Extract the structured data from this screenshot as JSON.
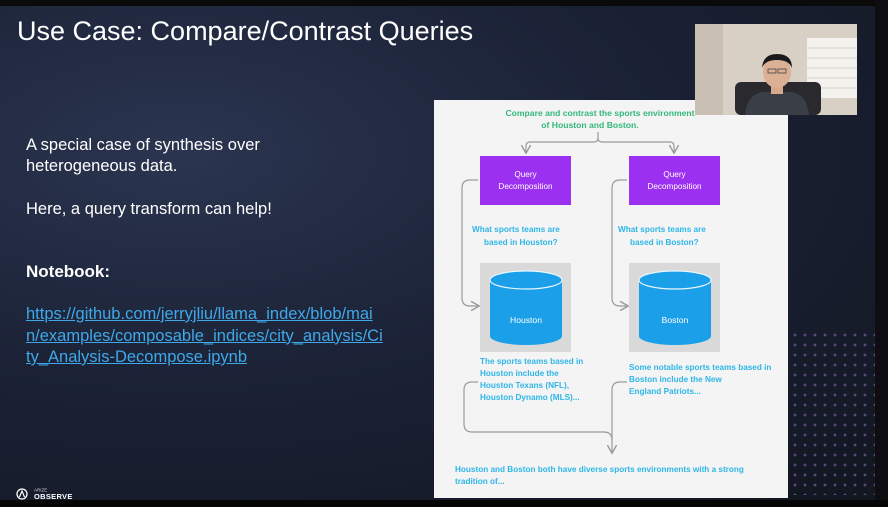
{
  "slide": {
    "title": "Use Case: Compare/Contrast Queries",
    "intro_line1": "A special case of synthesis over",
    "intro_line2": "heterogeneous data.",
    "help_text": "Here, a query transform can help!",
    "notebook_heading": "Notebook:",
    "notebook_link": "https://github.com/jerryjliu/llama_index/blob/main/examples/composable_indices/city_analysis/City_Analysis-Decompose.ipynb"
  },
  "diagram": {
    "top_query_line1": "Compare and contrast the sports environment",
    "top_query_line2": "of Houston and Boston.",
    "left_box_line1": "Query",
    "left_box_line2": "Decomposition",
    "right_box_line1": "Query",
    "right_box_line2": "Decomposition",
    "left_subq_line1": "What sports teams are",
    "left_subq_line2": "based in Houston?",
    "right_subq_line1": "What sports teams are",
    "right_subq_line2": "based in Boston?",
    "left_db_label": "Houston",
    "right_db_label": "Boston",
    "left_ans_line1": "The sports teams based in",
    "left_ans_line2": "Houston include the",
    "left_ans_line3": "Houston Texans (NFL),",
    "left_ans_line4": "Houston Dynamo (MLS)...",
    "right_ans_line1": "Some notable sports teams based in",
    "right_ans_line2": "Boston include the New",
    "right_ans_line3": "England Patriots...",
    "final_line1": "Houston and Boston both have diverse sports environments with a strong",
    "final_line2": "tradition of..."
  },
  "footer": {
    "logo_small": "ARIZE",
    "logo_text": "OBSERVE"
  },
  "colors": {
    "text_green": "#34b87a",
    "text_blue": "#2eb6e8",
    "box_purple": "#9b30f0",
    "db_blue": "#1a9fe8",
    "link_blue": "#3fa8e8"
  }
}
